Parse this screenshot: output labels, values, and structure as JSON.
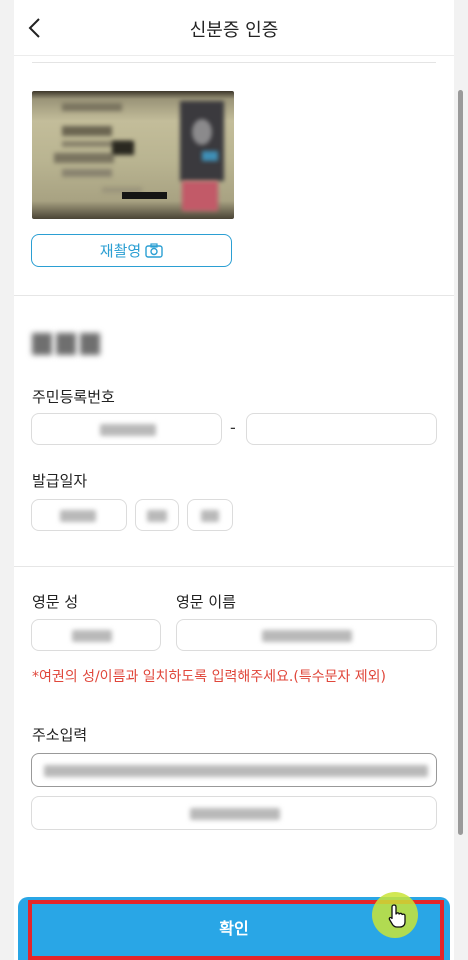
{
  "header": {
    "title": "신분증 인증"
  },
  "id_card": {
    "retake_label": "재촬영"
  },
  "resident_number": {
    "label": "주민등록번호",
    "separator": "-"
  },
  "issue_date": {
    "label": "발급일자"
  },
  "english_name": {
    "last_label": "영문 성",
    "first_label": "영문 이름",
    "notice": "*여권의 성/이름과 일치하도록 입력해주세요.(특수문자 제외)"
  },
  "address": {
    "label": "주소입력"
  },
  "footer": {
    "confirm_label": "확인"
  },
  "colors": {
    "accent": "#29a6e6",
    "warning": "#e0473b",
    "highlight": "#e5252a"
  }
}
